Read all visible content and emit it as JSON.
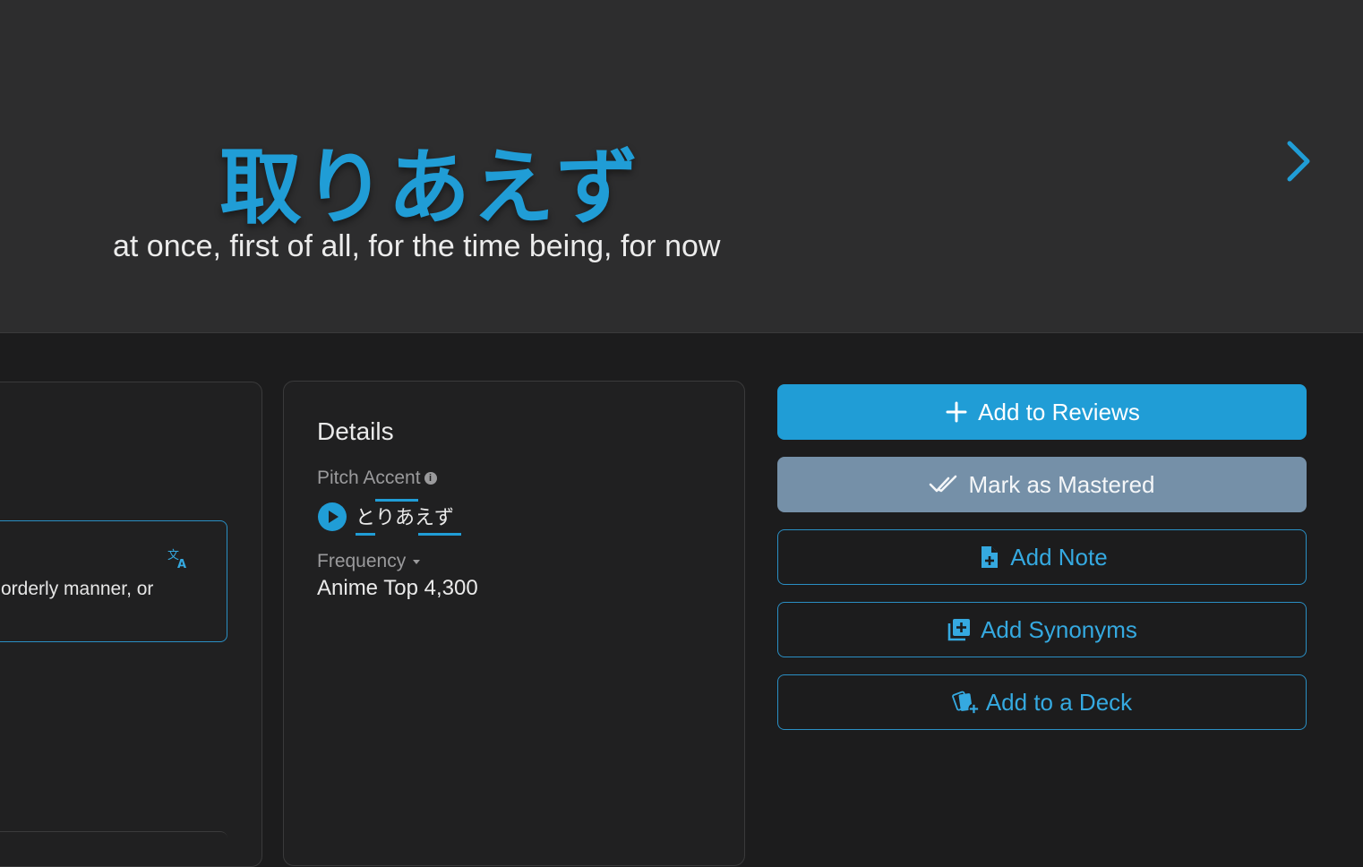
{
  "hero": {
    "word": "取りあえず",
    "meaning": "at once, first of all, for the time being, for now",
    "next_icon": "chevron-right-icon"
  },
  "meaning_card": {
    "text": "orderly manner, or",
    "translate_icon": "translate-icon"
  },
  "details": {
    "title": "Details",
    "pitch_accent_label": "Pitch Accent",
    "pitch_reading": "とりあえず",
    "frequency_label": "Frequency",
    "frequency_value": "Anime Top 4,300"
  },
  "actions": {
    "add_to_reviews": "Add to Reviews",
    "mark_as_mastered": "Mark as Mastered",
    "add_note": "Add Note",
    "add_synonyms": "Add Synonyms",
    "add_to_deck": "Add to a Deck"
  },
  "colors": {
    "accent": "#209dd6",
    "secondary_button": "#7590a8",
    "hero_background": "#2d2d2e",
    "page_background": "#1c1c1d"
  }
}
